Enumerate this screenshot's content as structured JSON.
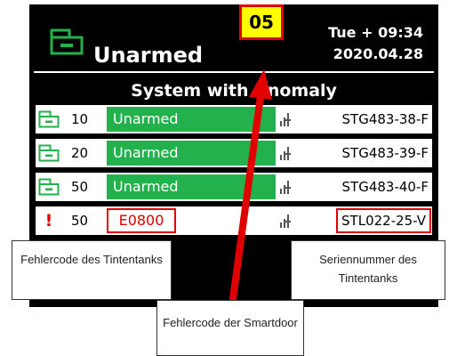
{
  "header": {
    "arm_status": "Unarmed",
    "day_time": "Tue + 09:34",
    "date": "2020.04.28"
  },
  "smartdoor_error_code": "05",
  "banner": "System with Anomaly",
  "rows": [
    {
      "icon": "storage-box-icon",
      "level": "10",
      "state": "Unarmed",
      "serial": "STG483-38-F"
    },
    {
      "icon": "storage-box-icon",
      "level": "20",
      "state": "Unarmed",
      "serial": "STG483-39-F"
    },
    {
      "icon": "storage-box-icon",
      "level": "50",
      "state": "Unarmed",
      "serial": "STG483-40-F"
    },
    {
      "icon": "exclamation-icon",
      "level": "50",
      "state": "E0800",
      "serial": "STL022-25-V"
    }
  ],
  "callouts": {
    "ink_error_code": "Fehlercode des Tintentanks",
    "ink_serial": "Seriennummer des Tintentanks",
    "smartdoor_error": "Fehlercode der Smartdoor"
  },
  "colors": {
    "armed_state_green": "#23b14d",
    "highlight_red": "#e00000",
    "code_yellow": "#ffff00"
  }
}
